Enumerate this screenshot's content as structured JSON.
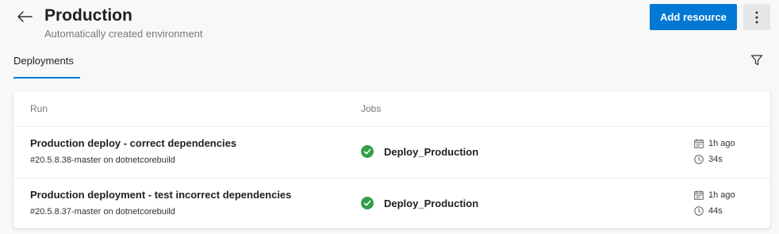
{
  "header": {
    "title": "Production",
    "subtitle": "Automatically created environment",
    "add_resource_label": "Add resource"
  },
  "tabs": [
    {
      "label": "Deployments",
      "selected": true
    }
  ],
  "table": {
    "columns": [
      "Run",
      "Jobs"
    ],
    "rows": [
      {
        "title": "Production deploy - correct dependencies",
        "subtitle": "#20.5.8.38-master on dotnetcorebuild",
        "job": "Deploy_Production",
        "job_status": "succeeded",
        "time_ago": "1h ago",
        "duration": "34s"
      },
      {
        "title": "Production deployment - test incorrect dependencies",
        "subtitle": "#20.5.8.37-master on dotnetcorebuild",
        "job": "Deploy_Production",
        "job_status": "succeeded",
        "time_ago": "1h ago",
        "duration": "44s"
      }
    ]
  },
  "icons": {
    "back": "arrow-left-icon",
    "more": "more-vertical-icon",
    "filter": "filter-icon",
    "success": "check-circle-icon",
    "calendar": "calendar-icon",
    "clock": "clock-icon"
  },
  "colors": {
    "accent": "#0078d4",
    "success": "#339e4a",
    "background": "#f8f8f8"
  }
}
